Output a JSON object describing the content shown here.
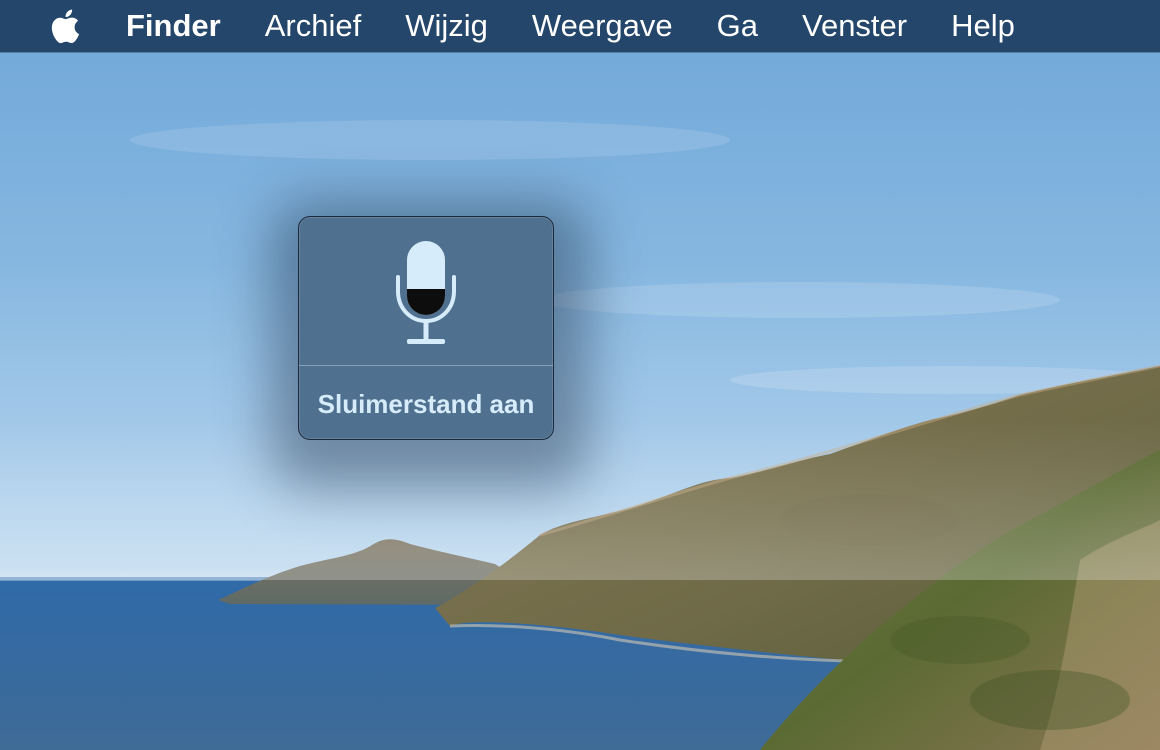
{
  "menubar": {
    "apple_icon": "apple-logo-icon",
    "app_name": "Finder",
    "items": [
      "Archief",
      "Wijzig",
      "Weergave",
      "Ga",
      "Venster",
      "Help"
    ],
    "background": "#24466b"
  },
  "dictation_hud": {
    "icon": "microphone-icon",
    "status": "Sluimerstand aan",
    "background": "#50708f",
    "label_color": "#d6ecfa"
  },
  "wallpaper": {
    "name": "macOS Catalina coastline"
  }
}
